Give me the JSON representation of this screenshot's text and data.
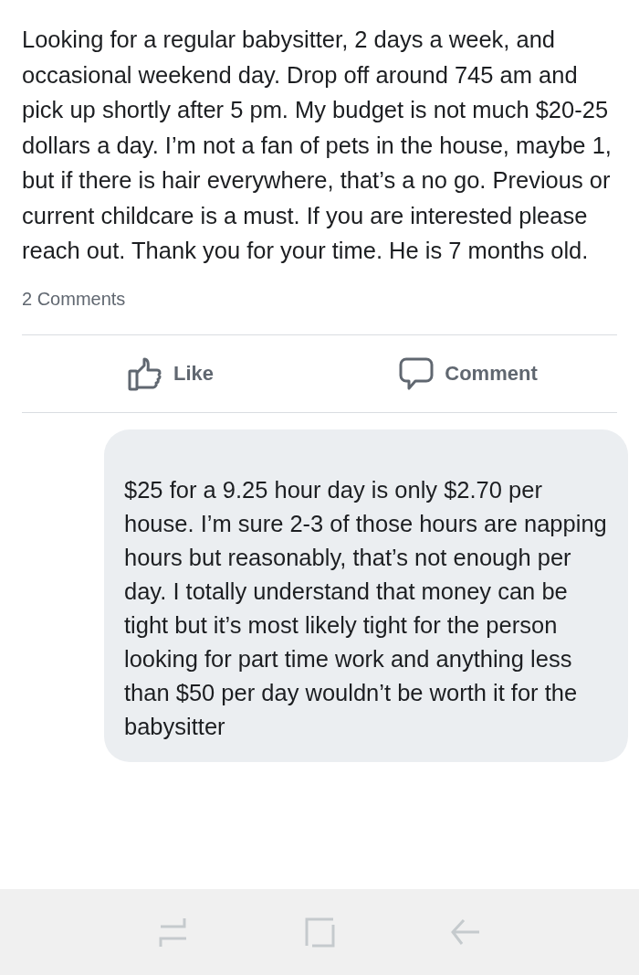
{
  "post": {
    "text": "Looking for a regular babysitter, 2 days a week, and occasional weekend day. Drop off around 745 am and pick up shortly after 5 pm. My budget is not much $20-25 dollars a day. I’m not a fan of pets in the house, maybe 1, but if there is hair everywhere, that’s a no go. Previous or current childcare is a must. If you are interested please reach out. Thank you for your time. He is 7 months old.",
    "comment_count": "2 Comments"
  },
  "actions": [
    {
      "kind": "like",
      "label": "Like"
    },
    {
      "kind": "comment",
      "label": "Comment"
    }
  ],
  "comment": {
    "text": "$25 for a 9.25 hour day is only $2.70 per house. I’m sure 2-3 of those hours are napping hours but reasonably, that’s not enough per day. I totally understand that money can be tight but it’s most likely tight for the person looking for part time work and anything less than $50 per day wouldn’t be worth it for the babysitter"
  }
}
